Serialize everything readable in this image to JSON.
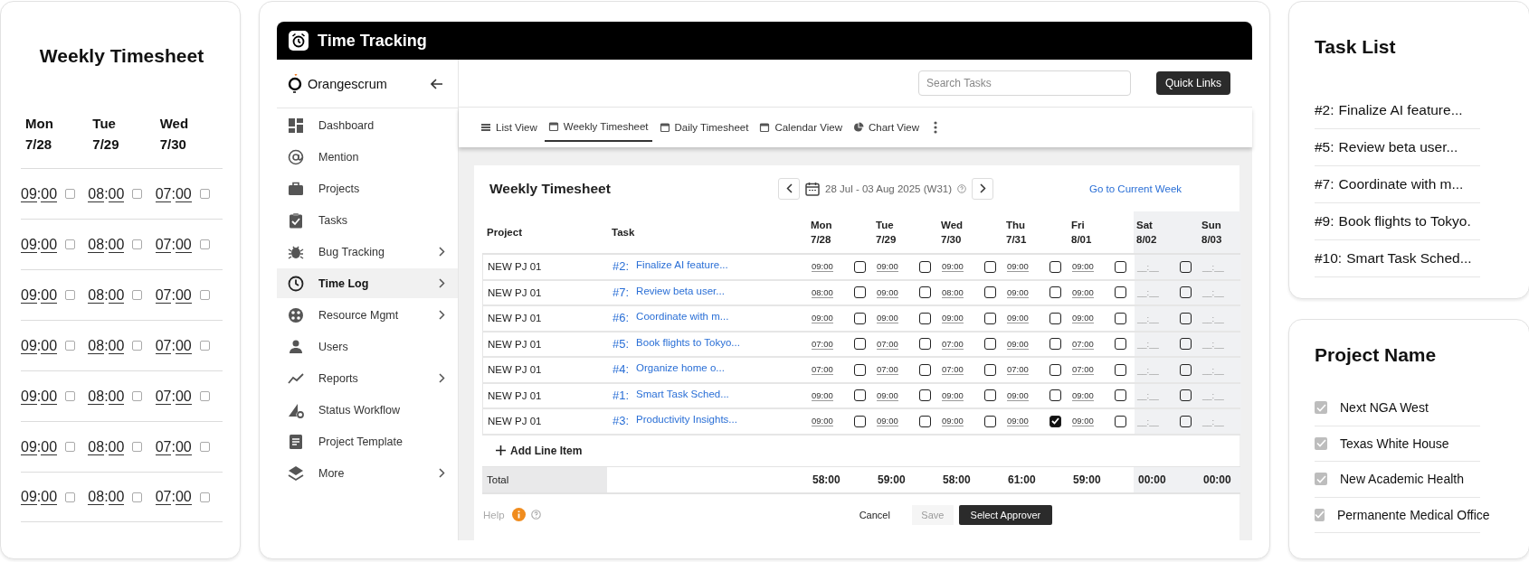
{
  "weekly_timesheet_card": {
    "title": "Weekly Timesheet",
    "days": [
      {
        "day": "Mon",
        "date": "7/28"
      },
      {
        "day": "Tue",
        "date": "7/29"
      },
      {
        "day": "Wed",
        "date": "7/30"
      }
    ],
    "rows": [
      {
        "entries": [
          {
            "time": "09:00",
            "checked": false
          },
          {
            "time": "08:00",
            "checked": false
          },
          {
            "time": "07:00",
            "checked": false
          }
        ]
      },
      {
        "entries": [
          {
            "time": "09:00",
            "checked": false
          },
          {
            "time": "08:00",
            "checked": false
          },
          {
            "time": "07:00",
            "checked": false
          }
        ]
      },
      {
        "entries": [
          {
            "time": "09:00",
            "checked": false
          },
          {
            "time": "08:00",
            "checked": false
          },
          {
            "time": "07:00",
            "checked": false
          }
        ]
      },
      {
        "entries": [
          {
            "time": "09:00",
            "checked": false
          },
          {
            "time": "08:00",
            "checked": false
          },
          {
            "time": "07:00",
            "checked": false
          }
        ]
      },
      {
        "entries": [
          {
            "time": "09:00",
            "checked": false
          },
          {
            "time": "08:00",
            "checked": false
          },
          {
            "time": "07:00",
            "checked": false
          }
        ]
      },
      {
        "entries": [
          {
            "time": "09:00",
            "checked": false
          },
          {
            "time": "08:00",
            "checked": false
          },
          {
            "time": "07:00",
            "checked": false
          }
        ]
      },
      {
        "entries": [
          {
            "time": "09:00",
            "checked": false
          },
          {
            "time": "08:00",
            "checked": false
          },
          {
            "time": "07:00",
            "checked": false
          }
        ]
      }
    ]
  },
  "app_window": {
    "title": "Time Tracking",
    "logo": "Orangescrum",
    "sidebar": {
      "items": [
        {
          "label": "Dashboard",
          "selected": false,
          "expandable": false
        },
        {
          "label": "Mention",
          "selected": false,
          "expandable": false
        },
        {
          "label": "Projects",
          "selected": false,
          "expandable": false
        },
        {
          "label": "Tasks",
          "selected": false,
          "expandable": false
        },
        {
          "label": "Bug Tracking",
          "selected": false,
          "expandable": true
        },
        {
          "label": "Time Log",
          "selected": true,
          "expandable": true
        },
        {
          "label": "Resource Mgmt",
          "selected": false,
          "expandable": true
        },
        {
          "label": "Users",
          "selected": false,
          "expandable": false
        },
        {
          "label": "Reports",
          "selected": false,
          "expandable": true
        },
        {
          "label": "Status Workflow",
          "selected": false,
          "expandable": false
        },
        {
          "label": "Project Template",
          "selected": false,
          "expandable": false
        },
        {
          "label": "More",
          "selected": false,
          "expandable": true
        }
      ]
    },
    "search": {
      "placeholder": "Search Tasks"
    },
    "quick_links_button": "Quick Links",
    "tabs": [
      {
        "label": "List View",
        "selected": false
      },
      {
        "label": "Weekly Timesheet",
        "selected": true
      },
      {
        "label": "Daily Timesheet",
        "selected": false
      },
      {
        "label": "Calendar View",
        "selected": false
      },
      {
        "label": "Chart View",
        "selected": false
      }
    ],
    "timesheet": {
      "title": "Weekly Timesheet",
      "date_range": "28 Jul - 03 Aug 2025 (W31)",
      "current_week_link": "Go to Current Week",
      "columns": {
        "project": "Project",
        "task": "Task"
      },
      "days": [
        {
          "day": "Mon",
          "date": "7/28",
          "weekend": false
        },
        {
          "day": "Tue",
          "date": "7/29",
          "weekend": false
        },
        {
          "day": "Wed",
          "date": "7/30",
          "weekend": false
        },
        {
          "day": "Thu",
          "date": "7/31",
          "weekend": false
        },
        {
          "day": "Fri",
          "date": "8/01",
          "weekend": false
        },
        {
          "day": "Sat",
          "date": "8/02",
          "weekend": true
        },
        {
          "day": "Sun",
          "date": "8/03",
          "weekend": true
        }
      ],
      "rows": [
        {
          "project": "NEW PJ 01",
          "task_id": "#2:",
          "task": "Finalize AI feature...",
          "entries": [
            {
              "time": "09:00",
              "checked": false
            },
            {
              "time": "09:00",
              "checked": false
            },
            {
              "time": "09:00",
              "checked": false
            },
            {
              "time": "09:00",
              "checked": false
            },
            {
              "time": "09:00",
              "checked": false
            },
            {
              "placeholder": "__:__",
              "checked": false
            },
            {
              "placeholder": "__:__"
            }
          ]
        },
        {
          "project": "NEW PJ 01",
          "task_id": "#7:",
          "task": "Review beta user...",
          "entries": [
            {
              "time": "08:00",
              "checked": false
            },
            {
              "time": "09:00",
              "checked": false
            },
            {
              "time": "08:00",
              "checked": false
            },
            {
              "time": "09:00",
              "checked": false
            },
            {
              "time": "09:00",
              "checked": false
            },
            {
              "placeholder": "__:__",
              "checked": false
            },
            {
              "placeholder": "__:__"
            }
          ]
        },
        {
          "project": "NEW PJ 01",
          "task_id": "#6:",
          "task": "Coordinate with m...",
          "entries": [
            {
              "time": "09:00",
              "checked": false
            },
            {
              "time": "09:00",
              "checked": false
            },
            {
              "time": "09:00",
              "checked": false
            },
            {
              "time": "09:00",
              "checked": false
            },
            {
              "time": "09:00",
              "checked": false
            },
            {
              "placeholder": "__:__",
              "checked": false
            },
            {
              "placeholder": "__:__"
            }
          ]
        },
        {
          "project": "NEW PJ 01",
          "task_id": "#5:",
          "task": "Book flights to Tokyo...",
          "entries": [
            {
              "time": "07:00",
              "checked": false
            },
            {
              "time": "07:00",
              "checked": false
            },
            {
              "time": "07:00",
              "checked": false
            },
            {
              "time": "09:00",
              "checked": false
            },
            {
              "time": "07:00",
              "checked": false
            },
            {
              "placeholder": "__:__",
              "checked": false
            },
            {
              "placeholder": "__:__"
            }
          ]
        },
        {
          "project": "NEW PJ 01",
          "task_id": "#4:",
          "task": "Organize home o...",
          "entries": [
            {
              "time": "07:00",
              "checked": false
            },
            {
              "time": "07:00",
              "checked": false
            },
            {
              "time": "07:00",
              "checked": false
            },
            {
              "time": "07:00",
              "checked": false
            },
            {
              "time": "07:00",
              "checked": false
            },
            {
              "placeholder": "__:__",
              "checked": false
            },
            {
              "placeholder": "__:__"
            }
          ]
        },
        {
          "project": "NEW PJ 01",
          "task_id": "#1:",
          "task": "Smart Task Sched...",
          "entries": [
            {
              "time": "09:00",
              "checked": false
            },
            {
              "time": "09:00",
              "checked": false
            },
            {
              "time": "09:00",
              "checked": false
            },
            {
              "time": "09:00",
              "checked": false
            },
            {
              "time": "09:00",
              "checked": false
            },
            {
              "placeholder": "__:__",
              "checked": false
            },
            {
              "placeholder": "__:__"
            }
          ]
        },
        {
          "project": "NEW PJ 01",
          "task_id": "#3:",
          "task": "Productivity Insights...",
          "entries": [
            {
              "time": "09:00",
              "checked": false
            },
            {
              "time": "09:00",
              "checked": false
            },
            {
              "time": "09:00",
              "checked": false
            },
            {
              "time": "09:00",
              "checked": true
            },
            {
              "time": "09:00",
              "checked": false
            },
            {
              "placeholder": "__:__",
              "checked": false
            },
            {
              "placeholder": "__:__"
            }
          ]
        }
      ],
      "add_line_item": "Add Line Item",
      "total_label": "Total",
      "totals": [
        "58:00",
        "59:00",
        "58:00",
        "61:00",
        "59:00",
        "00:00",
        "00:00"
      ],
      "help": "Help",
      "cancel_button": "Cancel",
      "save_button": {
        "label": "Save",
        "disabled": true
      },
      "approver_button": "Select Approver"
    }
  },
  "task_list_card": {
    "title": "Task List",
    "items": [
      {
        "number": "#2:",
        "name": "Finalize AI feature..."
      },
      {
        "number": "#5:",
        "name": "Review beta user..."
      },
      {
        "number": "#7:",
        "name": "Coordinate with m..."
      },
      {
        "number": "#9:",
        "name": "Book flights to Tokyo."
      },
      {
        "number": "#10:",
        "name": "Smart Task Sched..."
      }
    ]
  },
  "project_name_card": {
    "title": "Project Name",
    "items": [
      {
        "label": "Next NGA West",
        "checked": true
      },
      {
        "label": "Texas White House",
        "checked": true
      },
      {
        "label": "New Academic Health",
        "checked": true
      },
      {
        "label": "Permanente Medical Office",
        "checked": true
      }
    ]
  }
}
